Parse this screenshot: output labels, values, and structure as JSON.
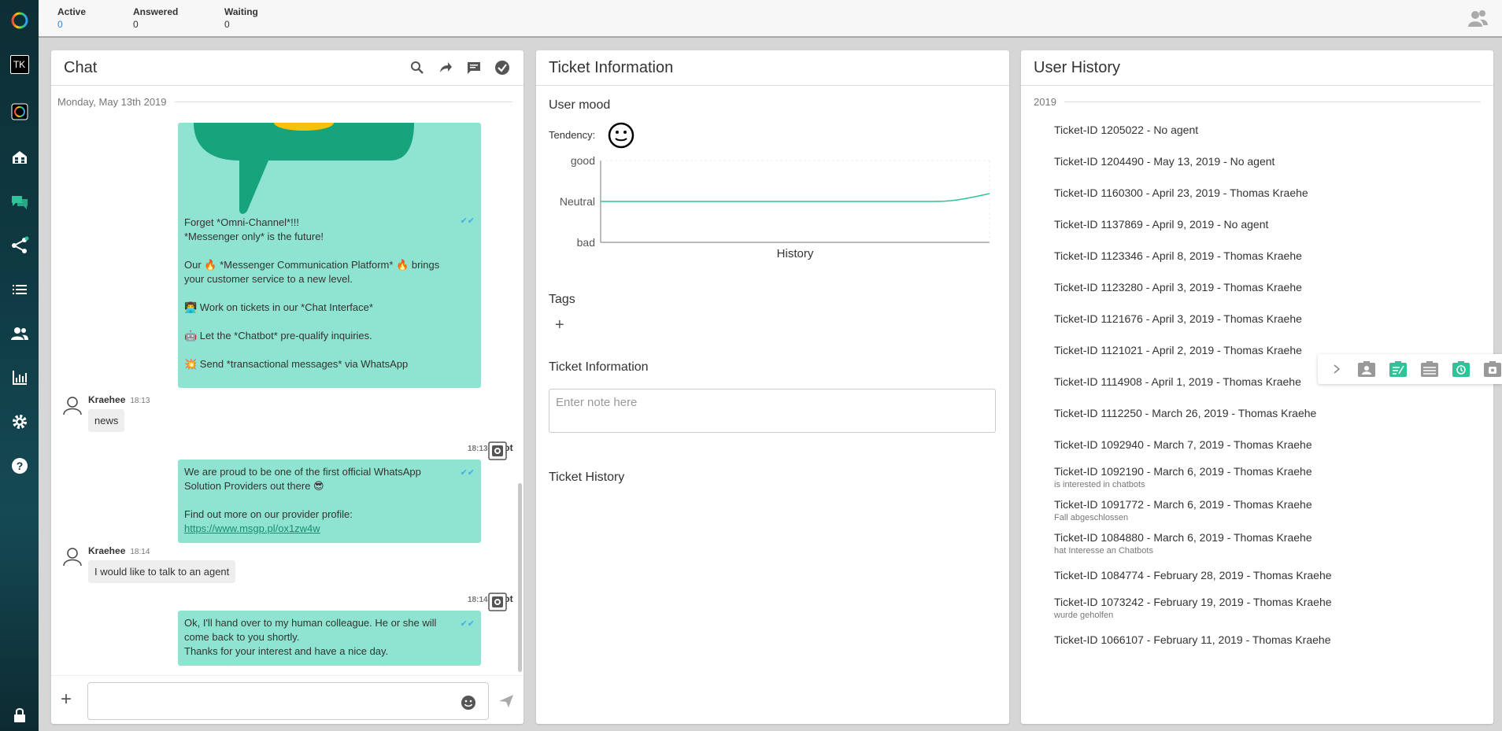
{
  "topbar": {
    "stats": [
      {
        "label": "Active",
        "value": "0"
      },
      {
        "label": "Answered",
        "value": "0"
      },
      {
        "label": "Waiting",
        "value": "0"
      }
    ]
  },
  "sidebar": {
    "user_initials": "TK",
    "items": [
      {
        "icon": "logo-ring-icon"
      },
      {
        "icon": "profile-icon"
      },
      {
        "icon": "app-switch-icon"
      },
      {
        "icon": "home-icon"
      },
      {
        "icon": "chat-icon"
      },
      {
        "icon": "share-icon"
      },
      {
        "icon": "list-icon"
      },
      {
        "icon": "users-icon"
      },
      {
        "icon": "bar-chart-icon"
      },
      {
        "icon": "gear-icon"
      },
      {
        "icon": "help-icon"
      },
      {
        "icon": "lock-icon"
      }
    ]
  },
  "chat": {
    "title": "Chat",
    "date": "Monday, May 13th 2019",
    "messages": [
      {
        "author": "Bot",
        "lines": [
          "Forget *Omni-Channel*!!!",
          "*Messenger only* is the future!",
          "",
          "Our 🔥 *Messenger Communication Platform* 🔥 brings",
          "your customer service to a new level.",
          "",
          "👨‍💻 Work on tickets in our *Chat Interface*",
          "",
          "🤖 Let the *Chatbot* pre-qualify inquiries.",
          "",
          "💥 Send *transactional messages* via WhatsApp"
        ]
      },
      {
        "author": "Kraehee",
        "time": "18:13",
        "text": "news"
      },
      {
        "author": "Bot",
        "time": "18:13",
        "lines": [
          "We are proud to be one of the first official WhatsApp",
          "Solution Providers out there 😎",
          "",
          "Find out more on our provider profile:"
        ],
        "link": "https://www.msgp.pl/ox1zw4w"
      },
      {
        "author": "Kraehee",
        "time": "18:14",
        "text": "I would like to talk to an agent"
      },
      {
        "author": "Bot",
        "time": "18:14",
        "lines": [
          "Ok, I'll hand over to my human colleague. He or she will",
          "come back to you shortly.",
          "Thanks for your interest and have a nice day."
        ]
      }
    ]
  },
  "ticket_info": {
    "title": "Ticket Information",
    "user_mood": "User mood",
    "tendency": "Tendency:",
    "mood_chart": {
      "y_labels": [
        "good",
        "Neutral",
        "bad"
      ],
      "x_label": "History"
    },
    "tags": "Tags",
    "ticket_information": "Ticket Information",
    "note_placeholder": "Enter note here",
    "ticket_history": "Ticket History"
  },
  "user_history": {
    "title": "User History",
    "year": "2019",
    "tickets": [
      {
        "text": "Ticket-ID 1205022 - No agent"
      },
      {
        "text": "Ticket-ID 1204490 - May 13, 2019 - No agent"
      },
      {
        "text": "Ticket-ID 1160300 - April 23, 2019 - Thomas Kraehe"
      },
      {
        "text": "Ticket-ID 1137869 - April 9, 2019 - No agent"
      },
      {
        "text": "Ticket-ID 1123346 - April 8, 2019 - Thomas Kraehe"
      },
      {
        "text": "Ticket-ID 1123280 - April 3, 2019 - Thomas Kraehe"
      },
      {
        "text": "Ticket-ID 1121676 - April 3, 2019 - Thomas Kraehe"
      },
      {
        "text": "Ticket-ID 1121021 - April 2, 2019 - Thomas Kraehe"
      },
      {
        "text": "Ticket-ID 1114908 - April 1, 2019 - Thomas Kraehe"
      },
      {
        "text": "Ticket-ID 1112250 - March 26, 2019 - Thomas Kraehe"
      },
      {
        "text": "Ticket-ID 1092940 - March 7, 2019 - Thomas Kraehe"
      },
      {
        "text": "Ticket-ID 1092190 - March 6, 2019 - Thomas Kraehe",
        "note": "is interested in chatbots"
      },
      {
        "text": "Ticket-ID 1091772 - March 6, 2019 - Thomas Kraehe",
        "note": "Fall abgeschlossen"
      },
      {
        "text": "Ticket-ID 1084880 - March 6, 2019 - Thomas Kraehe",
        "note": "hat Interesse an Chatbots"
      },
      {
        "text": "Ticket-ID 1084774 - February 28, 2019 - Thomas Kraehe"
      },
      {
        "text": "Ticket-ID 1073242 - February 19, 2019 - Thomas Kraehe",
        "note": "wurde geholfen"
      },
      {
        "text": "Ticket-ID 1066107 - February 11, 2019 - Thomas Kraehe"
      }
    ]
  },
  "colors": {
    "accent": "#2fc39a",
    "bot_bubble": "#8ee4d1",
    "user_bubble": "#eeeeee",
    "sidebar": "#0f3b44"
  }
}
